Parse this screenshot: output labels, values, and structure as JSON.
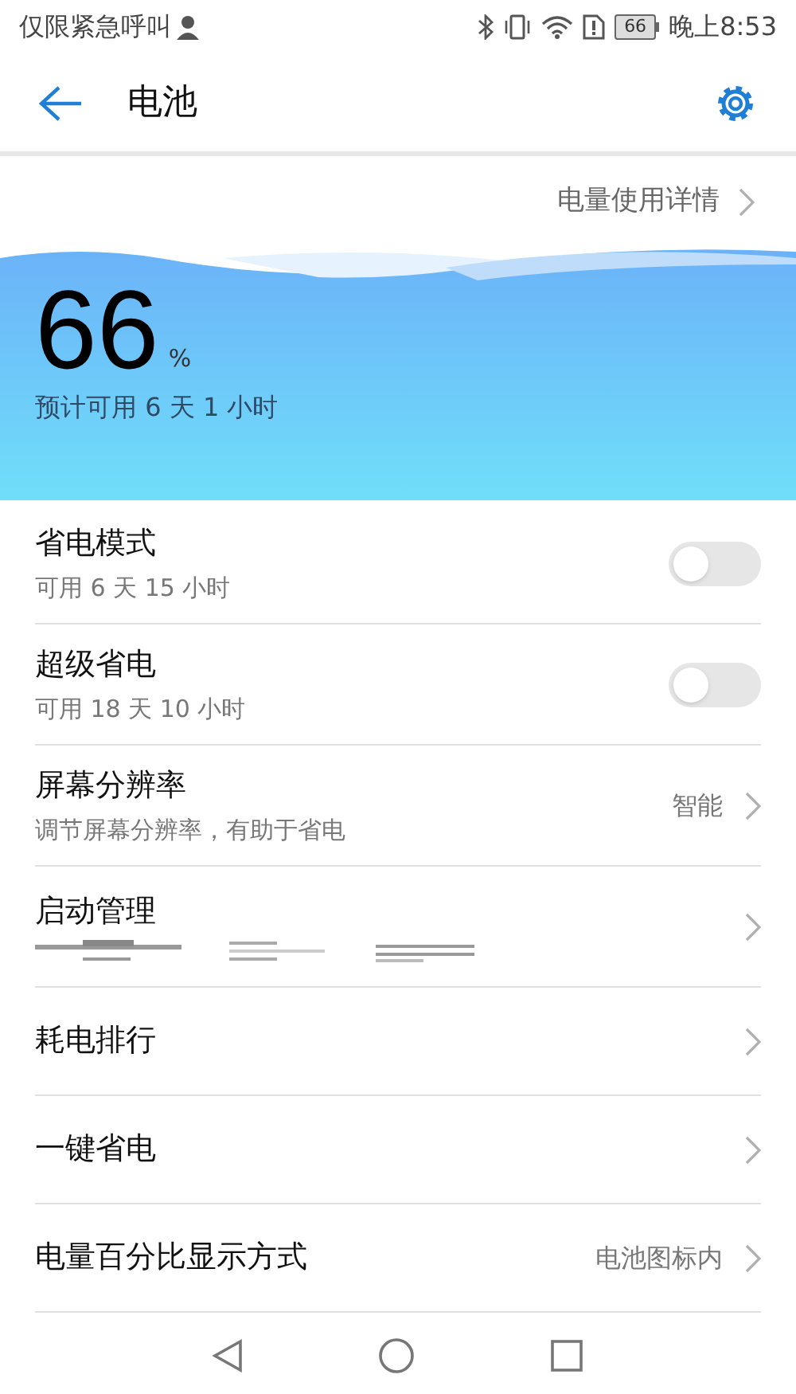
{
  "status_bar": {
    "carrier": "仅限紧急呼叫",
    "battery": "66",
    "time": "晚上8:53"
  },
  "header": {
    "title": "电池"
  },
  "details_link": "电量使用详情",
  "battery": {
    "percent": "66",
    "unit": "%",
    "estimate": "预计可用 6 天 1 小时"
  },
  "rows": [
    {
      "kind": "toggle",
      "title": "省电模式",
      "subtitle": "可用 6 天 15 小时",
      "on": false
    },
    {
      "kind": "toggle",
      "title": "超级省电",
      "subtitle": "可用 18 天 10 小时",
      "on": false
    },
    {
      "kind": "value",
      "title": "屏幕分辨率",
      "subtitle": "调节屏幕分辨率，有助于省电",
      "value": "智能"
    },
    {
      "kind": "startup",
      "title": "启动管理"
    },
    {
      "kind": "link",
      "title": "耗电排行"
    },
    {
      "kind": "link",
      "title": "一键省电"
    },
    {
      "kind": "value",
      "title": "电量百分比显示方式",
      "value": "电池图标内"
    }
  ]
}
